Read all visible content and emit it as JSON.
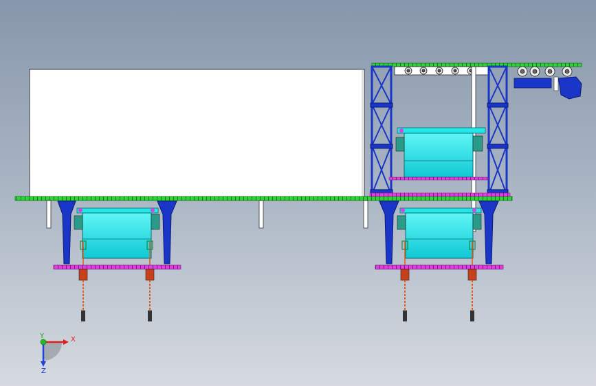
{
  "viewport": {
    "background_top": "#8797ab",
    "background_bottom": "#d6dae0"
  },
  "colors": {
    "truss": "#1a36c8",
    "rail": "#2ed33a",
    "beam": "#e040e0",
    "tank": "#22e8e8",
    "hose": "#e05a1e",
    "panel": "#ffffff",
    "outline": "#222222"
  },
  "triad": {
    "x_label": "X",
    "y_label": "Y",
    "z_label": "Z",
    "x_color": "#e02020",
    "y_color": "#20c020",
    "z_color": "#2040e0"
  }
}
